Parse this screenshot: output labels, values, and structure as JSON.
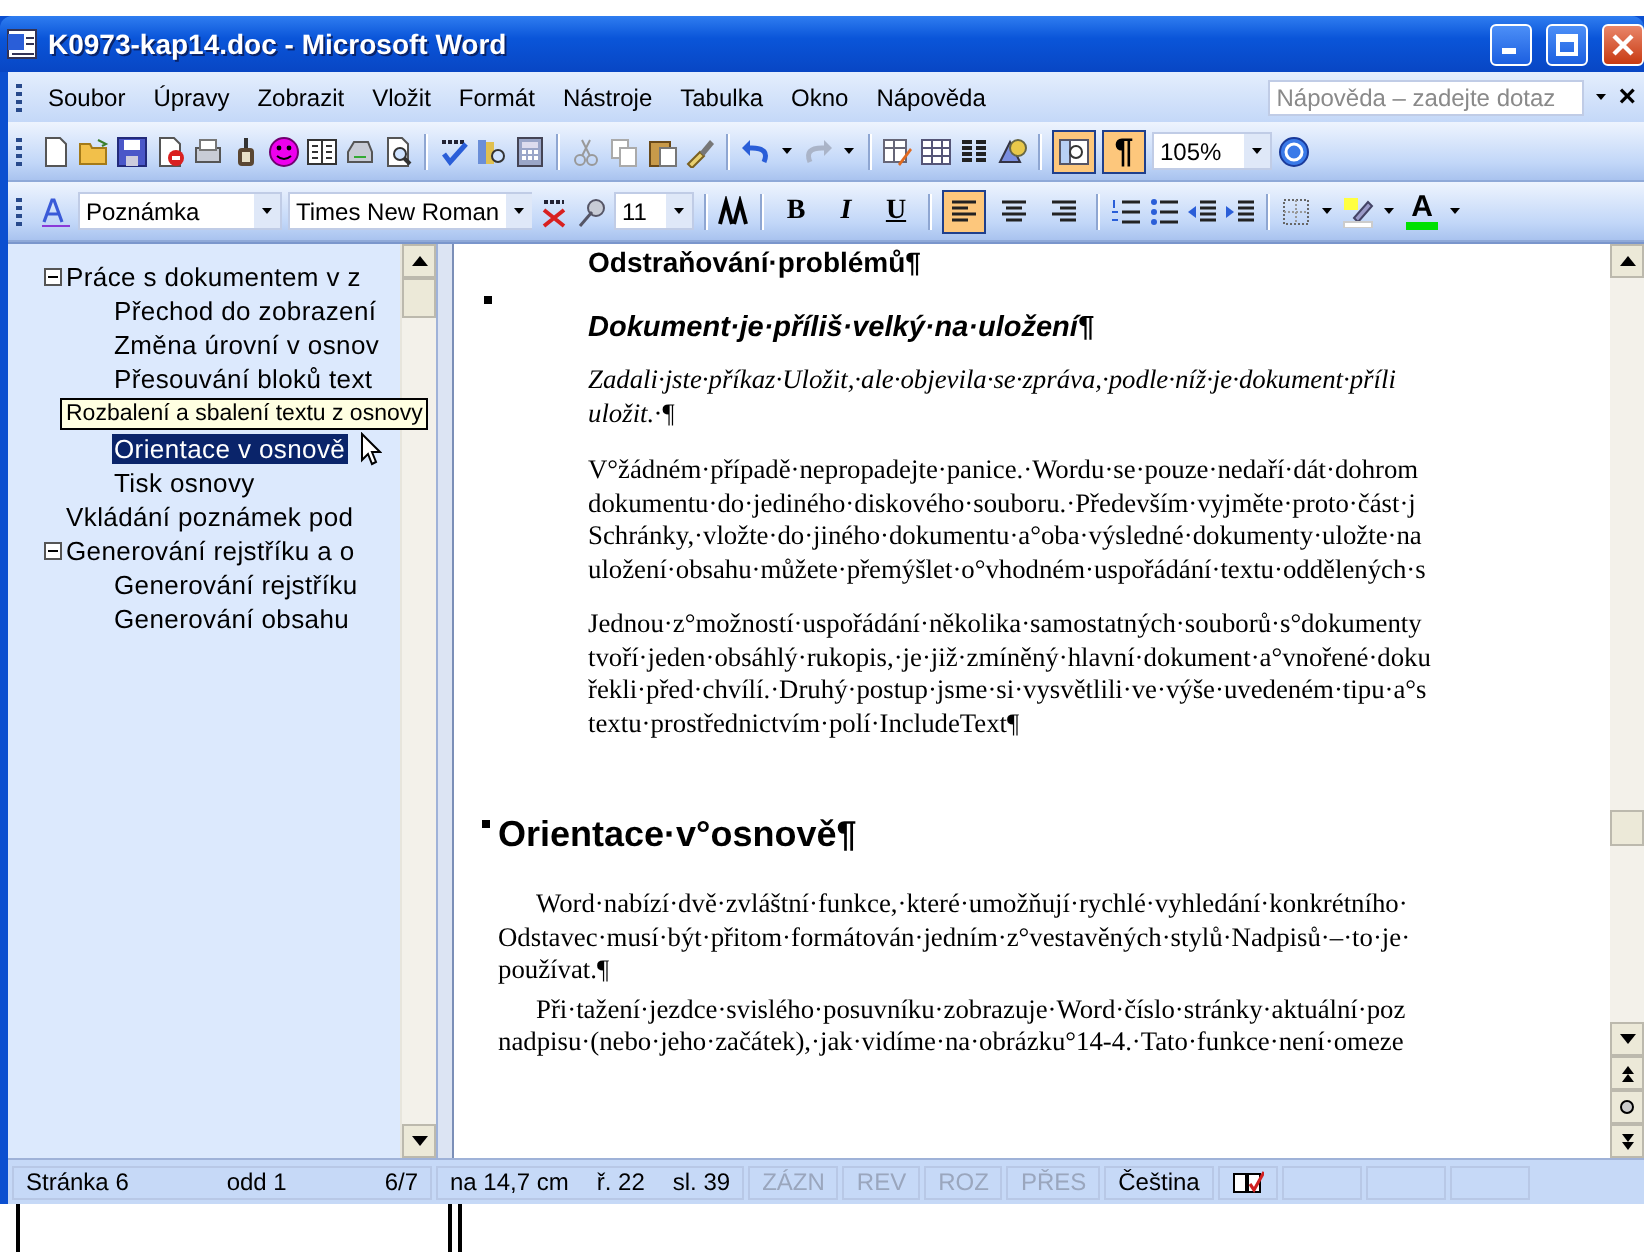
{
  "window": {
    "title": "K0973-kap14.doc - Microsoft Word"
  },
  "menu": [
    "Soubor",
    "Úpravy",
    "Zobrazit",
    "Vložit",
    "Formát",
    "Nástroje",
    "Tabulka",
    "Okno",
    "Nápověda"
  ],
  "help_box": {
    "placeholder": "Nápověda – zadejte dotaz",
    "close": "×"
  },
  "standard_toolbar": {
    "redo_disabled": true,
    "document_map_selected": true,
    "show_formatting": {
      "label": "¶",
      "selected": true
    },
    "zoom": "105%"
  },
  "formatting_toolbar": {
    "style": "Poznámka",
    "font": "Times New Roman",
    "size": "11",
    "text_buttons": [
      {
        "kind": "bold",
        "label": "B",
        "selected": false
      },
      {
        "kind": "italic",
        "label": "I",
        "selected": false
      },
      {
        "kind": "underline",
        "label": "U",
        "selected": false
      }
    ],
    "alignment": [
      {
        "kind": "left",
        "selected": true
      },
      {
        "kind": "center",
        "selected": false
      },
      {
        "kind": "right",
        "selected": false
      }
    ],
    "font_color": {
      "label": "A",
      "color": "#00e000"
    }
  },
  "document_map": {
    "items": [
      {
        "label": "Práce s dokumentem v z",
        "expanded": true,
        "children": [
          {
            "label": "Přechod do zobrazení",
            "selected": false
          },
          {
            "label": "Změna úrovní v osnov",
            "selected": false
          },
          {
            "label": "Přesouvání bloků text",
            "selected": false
          },
          {
            "kind": "tooltip",
            "label": "Rozbalení a sbalení textu z osnovy"
          },
          {
            "label": "Orientace v osnově",
            "selected": true
          },
          {
            "label": "Tisk osnovy",
            "selected": false
          }
        ]
      },
      {
        "label": "Vkládání poznámek pod",
        "selected": false
      },
      {
        "label": "Generování rejstříku a o",
        "expanded": true,
        "children": [
          {
            "label": "Generování rejstříku",
            "selected": false
          },
          {
            "label": "Generování obsahu",
            "selected": false
          }
        ]
      }
    ]
  },
  "document": {
    "blocks": [
      {
        "kind": "cut_heading",
        "lines": [
          "Odstraňování·problémů¶"
        ]
      },
      {
        "kind": "heading3",
        "lines": [
          "Dokument·je·příliš·velký·na·uložení¶"
        ]
      },
      {
        "kind": "italic",
        "lines": [
          "Zadali·jste·příkaz·Uložit,·ale·objevila·se·zpráva,·podle·níž·je·dokument·příli",
          "uložit.·¶"
        ]
      },
      {
        "kind": "body",
        "lines": [
          "V°žádném·případě·nepropadejte·panice.·Wordu·se·pouze·nedaří·dát·dohrom",
          "dokumentu·do·jediného·diskového·souboru.·Především·vyjměte·proto·část·j",
          "Schránky,·vložte·do·jiného·dokumentu·a°oba·výsledné·dokumenty·uložte·na",
          "uložení·obsahu·můžete·přemýšlet·o°vhodném·uspořádání·textu·oddělených·s"
        ]
      },
      {
        "kind": "body",
        "lines": [
          "Jednou·z°možností·uspořádání·několika·samostatných·souborů·s°dokumenty",
          "tvoří·jeden·obsáhlý·rukopis,·je·již·zmíněný·hlavní·dokument·a°vnořené·doku",
          "řekli·před·chvílí.·Druhý·postup·jsme·si·vysvětlili·ve·výše·uvedeném·tipu·a°s",
          "textu·prostřednictvím·polí·IncludeText¶"
        ]
      },
      {
        "kind": "heading2",
        "lines": [
          "Orientace·v°osnově¶"
        ]
      },
      {
        "kind": "body_wide",
        "lines": [
          "Word·nabízí·dvě·zvláštní·funkce,·které·umožňují·rychlé·vyhledání·konkrétního·",
          "Odstavec·musí·být·přitom·formátován·jedním·z°vestavěných·stylů·Nadpisů·–·to·je·",
          "používat.¶"
        ]
      },
      {
        "kind": "body_wide",
        "lines": [
          "Při·tažení·jezdce·svislého·posuvníku·zobrazuje·Word·číslo·stránky·aktuální·poz",
          "nadpisu·(nebo·jeho·začátek),·jak·vidíme·na·obrázku°14-4.·Tato·funkce·není·omeze"
        ]
      }
    ]
  },
  "status_bar": {
    "panels": [
      {
        "cells": [
          {
            "text": "Stránka 6",
            "disabled": false
          },
          {
            "text": "odd 1",
            "disabled": false
          },
          {
            "text": "6/7",
            "disabled": false
          }
        ]
      },
      {
        "cells": [
          {
            "text": "na 14,7 cm",
            "disabled": false
          },
          {
            "text": "ř. 22",
            "disabled": false
          },
          {
            "text": "sl. 39",
            "disabled": false
          }
        ]
      },
      {
        "cells": [
          {
            "text": "ZÁZN",
            "disabled": true
          }
        ]
      },
      {
        "cells": [
          {
            "text": "REV",
            "disabled": true
          }
        ]
      },
      {
        "cells": [
          {
            "text": "ROZ",
            "disabled": true
          }
        ]
      },
      {
        "cells": [
          {
            "text": "PŘES",
            "disabled": true
          }
        ]
      },
      {
        "cells": [
          {
            "text": "Čeština",
            "disabled": false
          }
        ]
      }
    ]
  }
}
